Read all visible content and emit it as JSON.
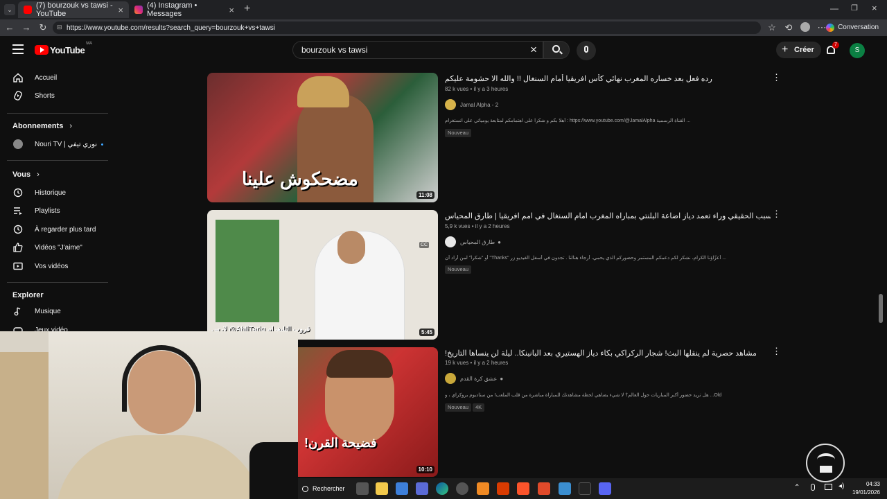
{
  "browser": {
    "tabs": [
      {
        "label": "(7) bourzouk vs tawsi - YouTube",
        "active": true
      },
      {
        "label": "(4) Instagram • Messages",
        "active": false
      }
    ],
    "url": "https://www.youtube.com/results?search_query=bourzouk+vs+tawsi",
    "conversation_label": "Conversation"
  },
  "youtube": {
    "logo_text": "YouTube",
    "region": "MA",
    "search_query": "bourzouk vs tawsi",
    "create_label": "Créer",
    "notification_count": "7",
    "avatar_letter": "S"
  },
  "sidebar": {
    "main": [
      {
        "label": "Accueil",
        "icon": "home-icon"
      },
      {
        "label": "Shorts",
        "icon": "shorts-icon"
      }
    ],
    "subscriptions_heading": "Abonnements",
    "subscriptions": [
      {
        "label": "Nouri TV | نوري تيفي"
      }
    ],
    "you_heading": "Vous",
    "you": [
      {
        "label": "Historique",
        "icon": "history-icon"
      },
      {
        "label": "Playlists",
        "icon": "playlists-icon"
      },
      {
        "label": "À regarder plus tard",
        "icon": "watch-later-icon"
      },
      {
        "label": "Vidéos \"J'aime\"",
        "icon": "thumbs-up-icon"
      },
      {
        "label": "Vos vidéos",
        "icon": "your-videos-icon"
      }
    ],
    "explore_heading": "Explorer",
    "explore": [
      {
        "label": "Musique",
        "icon": "music-icon"
      },
      {
        "label": "Jeux vidéo",
        "icon": "gaming-icon"
      }
    ]
  },
  "results": [
    {
      "title": "رده فعل بعد خساره المغرب نهائي كأس افريقيا أمام السنغال !! والله الا حشومة عليكم",
      "meta": "82 k vues • il y a 3 heures",
      "channel": "Jamal Alpha - 2",
      "description": "أهلا بكم و شكرا على اهتمامكم لمتابعة يومياتي على انستغرام : https://www.youtube.com/@JamalAlpha القناة الرسمية ...",
      "badges": [
        "Nouveau"
      ],
      "duration": "11:08",
      "thumb_text": "مضحكوش علينا"
    },
    {
      "title": "السبب الحقيقي وراء تعمد دياز اضاعة البلنتي بمباراه المغرب امام السنغال في امم افريقيا | طارق المحياس",
      "meta": "5,9 k vues • il y a 2 heures",
      "channel": "طارق المحياس",
      "description": "أو \"شكراً\" لمن أراد أن \"Thanks\" أعزّاؤنا الكرام، نشكر لكم دعمكم المستمر وحضوركم الذي يحمي، أرجاء هنالنا . تجدون في أسفل الفيديو زر ...",
      "badges": [
        "Nouveau"
      ],
      "duration": "5:45",
      "thumb_text": "قروب التليغرام AhliTariq@ لإرس"
    },
    {
      "title": "!مشاهد حصرية لم ينقلها البث! شجار الركراكي بكاء دياز الهستيري بعد البانينكا.. ليلة لن ينساها التاريخ",
      "meta": "19 k vues • il y a 2 heures",
      "channel": "عشق كرة القدم",
      "description": "هل تريد حضور أكبر المباريات حول العالم؟ لا شيء يضاهي لحظة مشاهدتك للمباراة مباشرة من قلب الملعب! من ستاديوم بروكراي ، و ...Old",
      "badges": [
        "Nouveau",
        "4K"
      ],
      "duration": "10:10",
      "thumb_text": "فضيحة القرن!"
    }
  ],
  "taskbar": {
    "search_label": "Rechercher",
    "time": "04:33",
    "date": "19/01/2026"
  },
  "colors": {
    "youtube_red": "#ff0000",
    "background": "#0f0f0f",
    "instagram_gradient": "#e1306c"
  }
}
